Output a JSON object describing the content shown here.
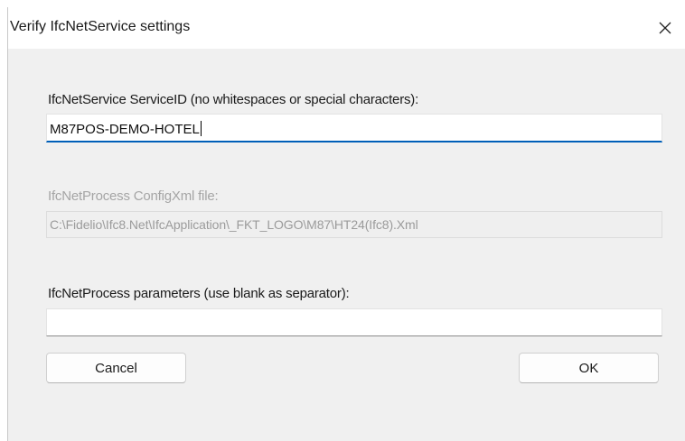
{
  "window": {
    "title": "Verify IfcNetService settings",
    "close_icon": "close-icon"
  },
  "service_id": {
    "label": "IfcNetService ServiceID (no whitespaces or special characters):",
    "value": "M87POS-DEMO-HOTEL"
  },
  "config_xml": {
    "label": "IfcNetProcess ConfigXml file:",
    "value": "C:\\Fidelio\\Ifc8.Net\\IfcApplication\\_FKT_LOGO\\M87\\HT24(Ifc8).Xml"
  },
  "parameters": {
    "label": "IfcNetProcess parameters (use blank as separator):",
    "value": ""
  },
  "buttons": {
    "cancel": "Cancel",
    "ok": "OK"
  },
  "colors": {
    "accent": "#005fb8",
    "dialog_bg": "#f0f0f0",
    "disabled_text": "#a5a5a5"
  }
}
